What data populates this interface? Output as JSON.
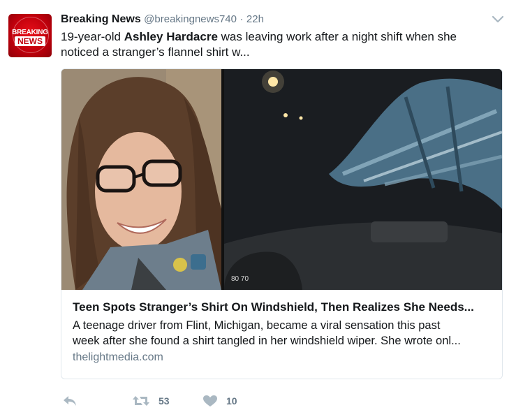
{
  "tweet": {
    "name": "Breaking News",
    "handle": "@breakingnews740",
    "separator": "·",
    "time": "22h",
    "text_line1_before": "19-year-old ",
    "text_line1_bold": "Ashley Hardacre",
    "text_line1_after": " was leaving work after a night shift when she",
    "text_line2": "noticed a stranger’s flannel shirt w..."
  },
  "avatar": {
    "line1": "BREAKING",
    "line2": "NEWS",
    "color": "#c2000c"
  },
  "card": {
    "title": "Teen Spots Stranger’s Shirt On Windshield, Then Realizes She Needs...",
    "desc_line1": "A teenage driver from Flint, Michigan, became a viral sensation this past",
    "desc_line2": "week after she found a shirt tangled in her windshield wiper. She wrote onl...",
    "domain": "thelightmedia.com"
  },
  "actions": {
    "reply_icon": "reply-icon",
    "retweet_icon": "retweet-icon",
    "retweet_count": "53",
    "like_icon": "heart-icon",
    "like_count": "10"
  },
  "colors": {
    "text": "#14171a",
    "secondary": "#657786",
    "icon": "#aab8c2",
    "border": "#e1e8ed"
  }
}
